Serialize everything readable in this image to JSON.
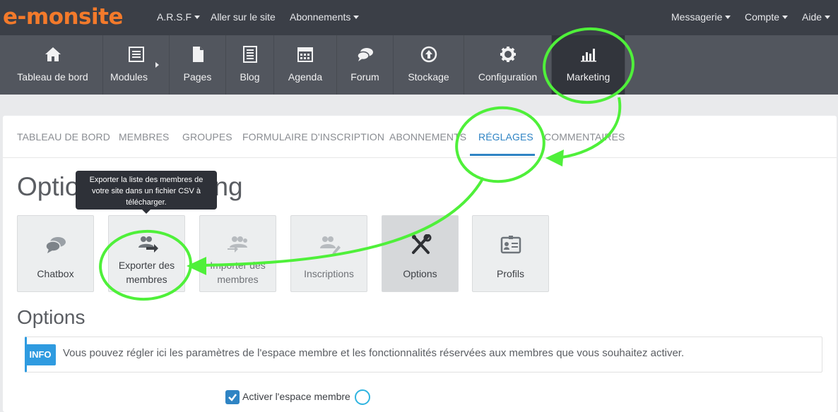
{
  "topbar": {
    "logo": "e-monsite",
    "site_menu": "A.R.S.F",
    "visit_site": "Aller sur le site",
    "subscriptions": "Abonnements",
    "messaging": "Messagerie",
    "account": "Compte",
    "help": "Aide"
  },
  "modules": [
    {
      "label": "Tableau de bord",
      "icon": "home-icon"
    },
    {
      "label": "Modules",
      "icon": "list-icon"
    },
    {
      "label": "Pages",
      "icon": "page-icon"
    },
    {
      "label": "Blog",
      "icon": "blog-icon"
    },
    {
      "label": "Agenda",
      "icon": "calendar-icon"
    },
    {
      "label": "Forum",
      "icon": "chat-icon"
    },
    {
      "label": "Stockage",
      "icon": "upload-icon"
    },
    {
      "label": "Configuration",
      "icon": "gear-icon"
    },
    {
      "label": "Marketing",
      "icon": "bar-chart-icon"
    }
  ],
  "tabs": [
    "TABLEAU DE BORD",
    "MEMBRES",
    "GROUPES",
    "FORMULAIRE D'INSCRIPTION",
    "ABONNEMENTS",
    "RÉGLAGES",
    "COMMENTAIRES"
  ],
  "active_tab": "RÉGLAGES",
  "page_title": "Optio",
  "page_title_tail": "ng",
  "tooltip": "Exporter la liste des membres de votre site dans un fichier CSV à télécharger.",
  "tiles": [
    {
      "label": "Chatbox",
      "icon": "chat-bubbles-icon"
    },
    {
      "label": "Exporter des membres",
      "icon": "users-export-icon"
    },
    {
      "label": "Importer des membres",
      "icon": "users-import-icon"
    },
    {
      "label": "Inscriptions",
      "icon": "users-edit-icon"
    },
    {
      "label": "Options",
      "icon": "tools-icon"
    },
    {
      "label": "Profils",
      "icon": "id-card-icon"
    }
  ],
  "section_title": "Options",
  "info": {
    "badge": "INFO",
    "text": "Vous pouvez régler ici les paramètres de l'espace membre et les fonctionnalités réservées aux membres que vous souhaitez activer."
  },
  "checkbox_label": "Activer l'espace membre",
  "colors": {
    "accent": "#2f84c4",
    "logo": "#f37a2b",
    "annotation": "#4ff03a"
  }
}
